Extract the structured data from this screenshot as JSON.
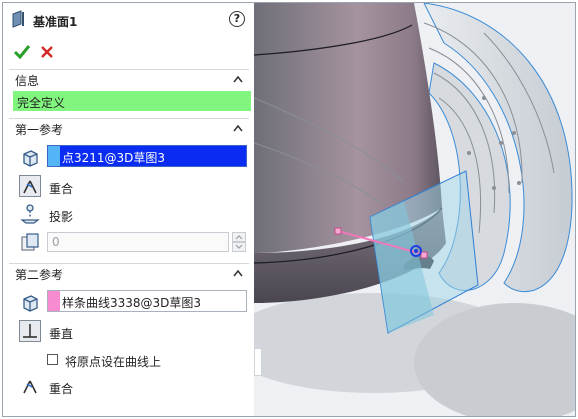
{
  "feature": {
    "title": "基准面1",
    "help_symbol": "?"
  },
  "actions": {
    "ok": "✔",
    "cancel": "✕"
  },
  "sections": {
    "info": {
      "title": "信息",
      "status_text": "完全定义"
    },
    "first_reference": {
      "title": "第一参考",
      "selection": "点3211@3D草图3",
      "options": [
        "重合",
        "投影"
      ],
      "spin_value": "0"
    },
    "second_reference": {
      "title": "第二参考",
      "selection": "样条曲线3338@3D草图3",
      "options": [
        "垂直",
        "重合"
      ],
      "checkbox_label": "将原点设在曲线上"
    }
  },
  "colors": {
    "status_green": "#82f57f",
    "first_ref_swatch": "#53b5f5",
    "second_ref_swatch": "#f78bd0",
    "active_selection": "#0a2bf2"
  }
}
